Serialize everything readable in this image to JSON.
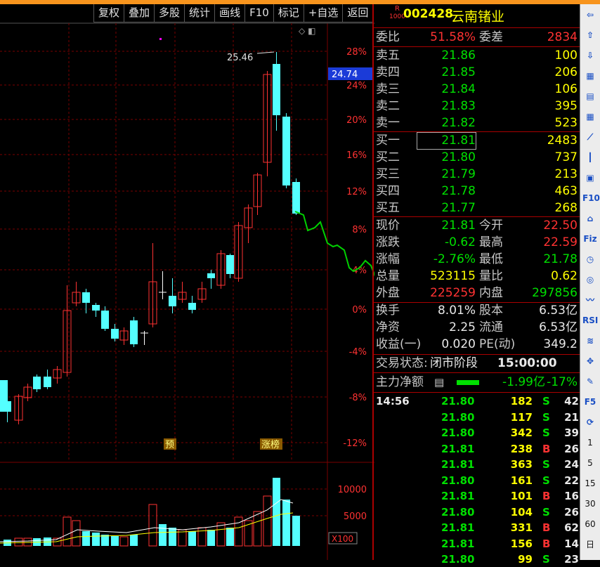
{
  "toolbar": {
    "items": [
      "复权",
      "叠加",
      "多股",
      "统计",
      "画线",
      "F10",
      "标记",
      "+自选",
      "返回"
    ]
  },
  "chart": {
    "price_ticks": [
      "28%",
      "24%",
      "20%",
      "16%",
      "12%",
      "8%",
      "4%",
      "0%",
      "-4%",
      "-8%",
      "-12%"
    ],
    "current_pct_label": "24.74",
    "high_annotation": "25.46",
    "markers": [
      "预",
      "涨榜"
    ],
    "volume_ticks": [
      "10000",
      "5000"
    ],
    "volume_unit": "X100",
    "colors": {
      "up": "#ff3232",
      "down": "#54ffff",
      "forecast": "#00d000",
      "ma1": "#ffffff",
      "ma2": "#ffff00",
      "grid": "#7a0000"
    }
  },
  "quote": {
    "badge_top": "R",
    "badge_bottom": "1000",
    "code": "002428",
    "name": "云南锗业",
    "weibi_label": "委比",
    "weibi": "51.58%",
    "weicha_label": "委差",
    "weicha": "2834",
    "asks": [
      {
        "label": "卖五",
        "price": "21.86",
        "vol": "100"
      },
      {
        "label": "卖四",
        "price": "21.85",
        "vol": "206"
      },
      {
        "label": "卖三",
        "price": "21.84",
        "vol": "106"
      },
      {
        "label": "卖二",
        "price": "21.83",
        "vol": "395"
      },
      {
        "label": "卖一",
        "price": "21.82",
        "vol": "523"
      }
    ],
    "bids": [
      {
        "label": "买一",
        "price": "21.81",
        "vol": "2483"
      },
      {
        "label": "买二",
        "price": "21.80",
        "vol": "737"
      },
      {
        "label": "买三",
        "price": "21.79",
        "vol": "213"
      },
      {
        "label": "买四",
        "price": "21.78",
        "vol": "463"
      },
      {
        "label": "买五",
        "price": "21.77",
        "vol": "268"
      }
    ],
    "stats": [
      {
        "l1": "现价",
        "v1": "21.81",
        "c1": "g",
        "l2": "今开",
        "v2": "22.50",
        "c2": "r"
      },
      {
        "l1": "涨跌",
        "v1": "-0.62",
        "c1": "g",
        "l2": "最高",
        "v2": "22.59",
        "c2": "r"
      },
      {
        "l1": "涨幅",
        "v1": "-2.76%",
        "c1": "g",
        "l2": "最低",
        "v2": "21.78",
        "c2": "g"
      },
      {
        "l1": "总量",
        "v1": "523115",
        "c1": "y",
        "l2": "量比",
        "v2": "0.62",
        "c2": "y"
      },
      {
        "l1": "外盘",
        "v1": "225259",
        "c1": "r",
        "l2": "内盘",
        "v2": "297856",
        "c2": "g"
      },
      {
        "l1": "换手",
        "v1": "8.01%",
        "c1": "w",
        "l2": "股本",
        "v2": "6.53亿",
        "c2": "w"
      },
      {
        "l1": "净资",
        "v1": "2.25",
        "c1": "w",
        "l2": "流通",
        "v2": "6.53亿",
        "c2": "w"
      },
      {
        "l1": "收益(一)",
        "v1": "0.020",
        "c1": "w",
        "l2": "PE(动)",
        "v2": "349.2",
        "c2": "w"
      }
    ],
    "status_label": "交易状态:",
    "status_value": "闭市阶段",
    "status_time": "15:00:00",
    "main_flow_label": "主力净额",
    "main_flow_value": "-1.99亿",
    "main_flow_pct": "-17%",
    "ticks": [
      {
        "time": "14:56",
        "price": "21.80",
        "vol": "182",
        "bs": "S",
        "n": "42"
      },
      {
        "time": "",
        "price": "21.80",
        "vol": "117",
        "bs": "S",
        "n": "21"
      },
      {
        "time": "",
        "price": "21.80",
        "vol": "342",
        "bs": "S",
        "n": "39"
      },
      {
        "time": "",
        "price": "21.81",
        "vol": "238",
        "bs": "B",
        "n": "26"
      },
      {
        "time": "",
        "price": "21.81",
        "vol": "363",
        "bs": "S",
        "n": "24"
      },
      {
        "time": "",
        "price": "21.80",
        "vol": "161",
        "bs": "S",
        "n": "22"
      },
      {
        "time": "",
        "price": "21.81",
        "vol": "101",
        "bs": "B",
        "n": "16"
      },
      {
        "time": "",
        "price": "21.80",
        "vol": "104",
        "bs": "S",
        "n": "26"
      },
      {
        "time": "",
        "price": "21.81",
        "vol": "331",
        "bs": "B",
        "n": "62"
      },
      {
        "time": "",
        "price": "21.81",
        "vol": "156",
        "bs": "B",
        "n": "14"
      },
      {
        "time": "",
        "price": "21.80",
        "vol": "99",
        "bs": "S",
        "n": "23"
      }
    ]
  },
  "sidebar": {
    "items": [
      {
        "icon": "arrow-left-icon",
        "text": "⇦"
      },
      {
        "icon": "arrow-up-icon",
        "text": "⇧"
      },
      {
        "icon": "arrow-down-icon",
        "text": "⇩"
      },
      {
        "icon": "grid-icon",
        "text": "▦"
      },
      {
        "icon": "list-icon",
        "text": "▤"
      },
      {
        "icon": "table-icon",
        "text": "▦"
      },
      {
        "icon": "line-chart-icon",
        "text": "⟋"
      },
      {
        "icon": "kline-icon",
        "text": "┃"
      },
      {
        "icon": "window-icon",
        "text": "▣"
      },
      {
        "icon": "f10-icon",
        "text": "F10"
      },
      {
        "icon": "building-icon",
        "text": "⌂"
      },
      {
        "icon": "fiz-icon",
        "text": "Fiz"
      },
      {
        "icon": "clock-icon",
        "text": "◷"
      },
      {
        "icon": "circle-icon",
        "text": "◎"
      },
      {
        "icon": "wave-icon",
        "text": "〰"
      },
      {
        "icon": "rsi-icon",
        "text": "RSI"
      },
      {
        "icon": "pattern-icon",
        "text": "≋"
      },
      {
        "icon": "move-icon",
        "text": "✥"
      },
      {
        "icon": "pen-icon",
        "text": "✎"
      },
      {
        "icon": "f5-icon",
        "text": "F5"
      },
      {
        "icon": "refresh-icon",
        "text": "⟳"
      },
      {
        "icon": "period-1",
        "text": "1"
      },
      {
        "icon": "period-5",
        "text": "5"
      },
      {
        "icon": "period-15",
        "text": "15"
      },
      {
        "icon": "period-30",
        "text": "30"
      },
      {
        "icon": "period-60",
        "text": "60"
      },
      {
        "icon": "period-day",
        "text": "日"
      }
    ]
  }
}
